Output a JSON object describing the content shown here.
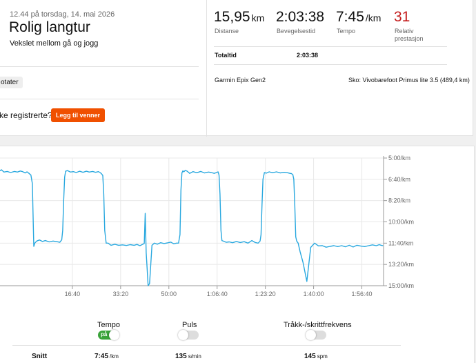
{
  "activity": {
    "date_line": "12.44 på torsdag, 14. mai 2026",
    "title": "Rolig langtur",
    "description": "Vekslet mellom gå og jogg",
    "tag": "otater",
    "register_prompt": "ke registrerte?",
    "add_friends_button": "Legg til venner"
  },
  "stats": [
    {
      "value": "15,95",
      "unit": "km",
      "label": "Distanse",
      "red": false
    },
    {
      "value": "2:03:38",
      "unit": "",
      "label": "Bevegelsestid",
      "red": false
    },
    {
      "value": "7:45",
      "unit": "/km",
      "label": "Tempo",
      "red": false
    },
    {
      "value": "31",
      "unit": "",
      "label": "Relativ prestasjon",
      "red": true
    }
  ],
  "total_time": {
    "label": "Totaltid",
    "value": "2:03:38"
  },
  "device": "Garmin Epix Gen2",
  "shoes": "Sko: Vivobarefoot Primus lite 3.5 (489,4 km)",
  "toggles": [
    {
      "label": "Tempo",
      "on": true,
      "on_text": "på"
    },
    {
      "label": "Puls",
      "on": false,
      "on_text": ""
    },
    {
      "label": "Tråkk-/skrittfrekvens",
      "on": false,
      "on_text": ""
    }
  ],
  "averages": {
    "label": "Snitt",
    "pace": {
      "value": "7:45",
      "unit": "/km"
    },
    "heart_rate": {
      "value": "135",
      "unit": "s/min"
    },
    "cadence": {
      "value": "145",
      "unit": "spm"
    }
  },
  "chart_data": {
    "type": "line",
    "x_unit": "elapsed time",
    "y_unit": "min/km",
    "y_inverted": true,
    "x_tick_labels": [
      "16:40",
      "33:20",
      "50:00",
      "1:06:40",
      "1:23:20",
      "1:40:00",
      "1:56:40"
    ],
    "x_tick_seconds": [
      1000,
      2000,
      3000,
      4000,
      5000,
      6000,
      7000
    ],
    "y_tick_labels": [
      "5:00/km",
      "6:40/km",
      "8:20/km",
      "10:00/km",
      "11:40/km",
      "13:20/km",
      "15:00/km"
    ],
    "y_tick_seconds": [
      300,
      400,
      500,
      600,
      700,
      800,
      900
    ],
    "xlim_seconds": [
      -500,
      7450
    ],
    "ylim_seconds": [
      300,
      900
    ],
    "line_color": "#29a8df",
    "series": [
      {
        "x": [
          -500,
          -470,
          -420,
          -350,
          -280,
          -200,
          -140,
          -80,
          -30,
          20,
          60,
          100,
          140,
          170,
          190,
          200,
          220,
          260,
          320,
          380,
          440,
          520,
          600,
          680,
          740,
          780,
          800,
          820,
          840,
          860,
          900,
          960,
          1020,
          1080,
          1150,
          1220,
          1290,
          1350,
          1420,
          1480,
          1540,
          1580,
          1610,
          1630,
          1650,
          1670,
          1700,
          1740,
          1800,
          1880,
          1960,
          2040,
          2120,
          2200,
          2280,
          2340,
          2400,
          2450,
          2490,
          2510,
          2530,
          2550,
          2570,
          2600,
          2650,
          2700,
          2760,
          2830,
          2900,
          2970,
          3040,
          3100,
          3160,
          3200,
          3230,
          3250,
          3270,
          3290,
          3310,
          3340,
          3380,
          3430,
          3500,
          3580,
          3660,
          3740,
          3820,
          3880,
          3940,
          3990,
          4020,
          4040,
          4060,
          4080,
          4100,
          4140,
          4190,
          4250,
          4320,
          4400,
          4480,
          4560,
          4640,
          4720,
          4790,
          4850,
          4890,
          4910,
          4930,
          4950,
          4980,
          5020,
          5080,
          5150,
          5230,
          5310,
          5390,
          5460,
          5510,
          5540,
          5570,
          5590,
          5610,
          5630,
          5650,
          5680,
          5720,
          5780,
          5860,
          5940,
          6020,
          6100,
          6180,
          6260,
          6340,
          6420,
          6500,
          6580,
          6660,
          6740,
          6820,
          6900,
          6980,
          7060,
          7140,
          7220,
          7300,
          7360,
          7400,
          7440
        ],
        "y": [
          360,
          355,
          366,
          363,
          368,
          363,
          366,
          361,
          364,
          370,
          365,
          372,
          380,
          420,
          620,
          715,
          700,
          690,
          685,
          692,
          688,
          694,
          690,
          693,
          696,
          684,
          640,
          500,
          390,
          362,
          359,
          366,
          364,
          368,
          362,
          367,
          362,
          366,
          363,
          367,
          364,
          369,
          376,
          382,
          470,
          640,
          700,
          700,
          710,
          705,
          710,
          708,
          711,
          707,
          710,
          706,
          712,
          706,
          702,
          560,
          745,
          820,
          900,
          890,
          710,
          700,
          705,
          698,
          702,
          699,
          695,
          703,
          700,
          700,
          660,
          450,
          370,
          360,
          365,
          358,
          362,
          372,
          364,
          369,
          363,
          370,
          366,
          368,
          372,
          368,
          365,
          380,
          470,
          640,
          688,
          691,
          696,
          694,
          698,
          692,
          697,
          693,
          700,
          688,
          697,
          700,
          690,
          660,
          520,
          400,
          368,
          371,
          365,
          369,
          365,
          370,
          367,
          369,
          372,
          373,
          378,
          400,
          520,
          670,
          690,
          700,
          740,
          790,
          880,
          720,
          700,
          713,
          712,
          719,
          715,
          712,
          716,
          712,
          717,
          710,
          718,
          710,
          714,
          716,
          712,
          708,
          712,
          707,
          710,
          712
        ]
      }
    ]
  }
}
